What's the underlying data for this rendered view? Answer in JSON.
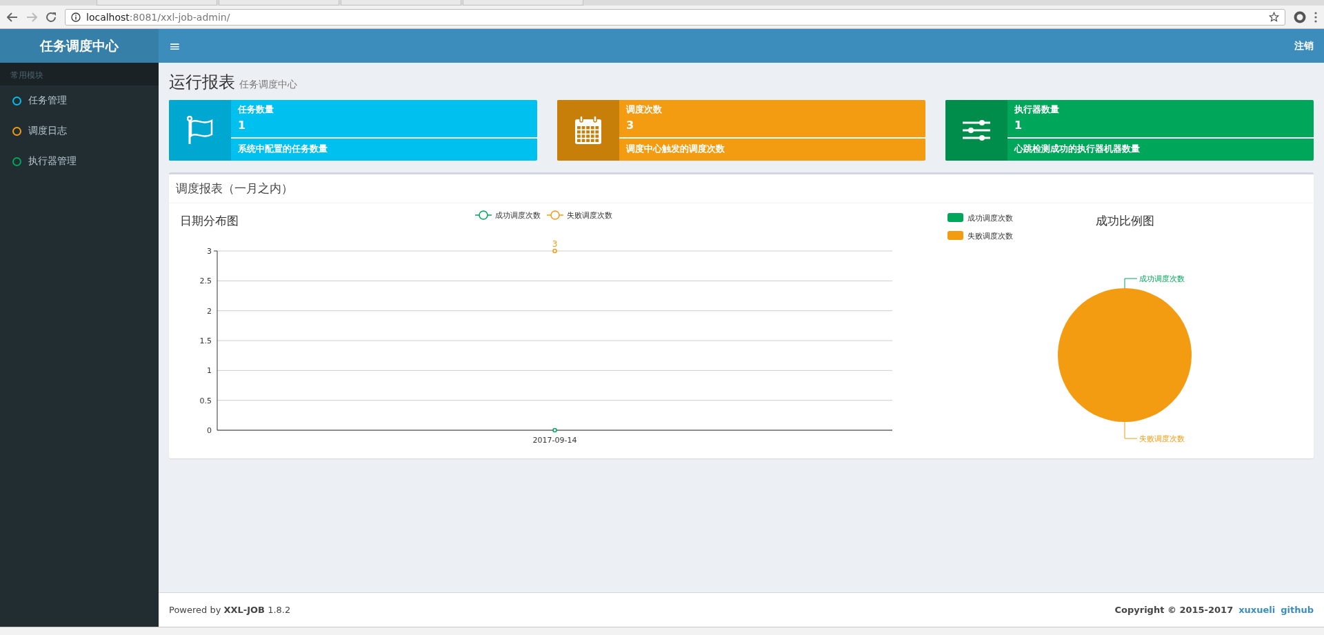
{
  "browser": {
    "url_host": "localhost",
    "url_path": ":8081/xxl-job-admin/"
  },
  "header": {
    "logo": "任务调度中心",
    "toggle": "≡",
    "logout": "注销"
  },
  "sidebar": {
    "section": "常用模块",
    "items": [
      {
        "label": "任务管理",
        "color": "#00c0ef",
        "selected": false
      },
      {
        "label": "调度日志",
        "color": "#f39c12",
        "selected": false
      },
      {
        "label": "执行器管理",
        "color": "#00a65a",
        "selected": false
      }
    ]
  },
  "page": {
    "title": "运行报表",
    "subtitle": "任务调度中心"
  },
  "info_boxes": [
    {
      "kind": "flag",
      "color": "#00c0ef",
      "title": "任务数量",
      "number": "1",
      "level": 1,
      "description": "系统中配置的任务数量"
    },
    {
      "kind": "calendar",
      "color": "#f39c12",
      "title": "调度次数",
      "number": "3",
      "level": 1,
      "description": "调度中心触发的调度次数"
    },
    {
      "kind": "sliders",
      "color": "#00a65a",
      "title": "执行器数量",
      "number": "1",
      "level": 1,
      "description": "心跳检测成功的执行器机器数量"
    }
  ],
  "report": {
    "title": "调度报表（一月之内）",
    "line_chart": {
      "chart_data": {
        "type": "line",
        "title": "日期分布图",
        "x": [
          "2017-09-14"
        ],
        "series": [
          {
            "name": "成功调度次数",
            "color": "#00a65a",
            "values": [
              0
            ],
            "marker": "circle"
          },
          {
            "name": "失败调度次数",
            "color": "#f39c12",
            "values": [
              3
            ],
            "marker": "circle"
          }
        ],
        "ylim": [
          0,
          3
        ],
        "yticks": [
          0,
          {
            "value": 0.5,
            "label": "0.5"
          },
          1,
          {
            "value": 1.5,
            "label": "1.5"
          },
          2,
          {
            "value": 2.5,
            "label": "2.5"
          },
          3
        ],
        "grid": true,
        "legend": true,
        "annotations": [
          {
            "x": "2017-09-14",
            "y": 3,
            "text": "3"
          }
        ]
      }
    },
    "pie_chart": {
      "chart_data": {
        "type": "pie",
        "title": "成功比例图",
        "categories": [
          "成功调度次数",
          "失败调度次数"
        ],
        "values": [
          0,
          100
        ],
        "colors": [
          "#00a65a",
          "#f39c12"
        ],
        "legend": true
      }
    }
  },
  "footer": {
    "powered": "Powered by **XXL-JOB** 1.8.2",
    "copyright": "Copyright © 2015-2017",
    "links": [
      "xuxueli",
      "github"
    ]
  }
}
